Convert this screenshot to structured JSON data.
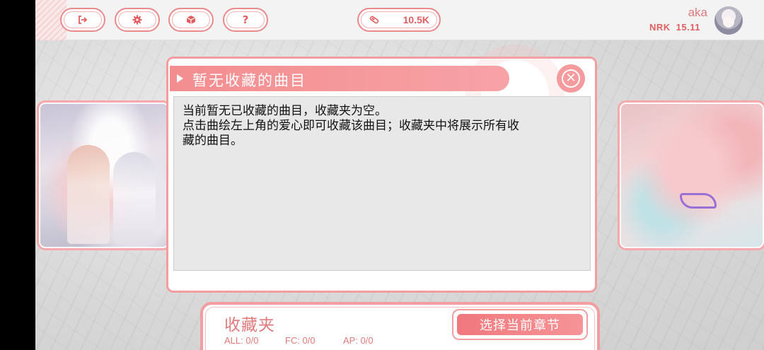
{
  "topbar": {
    "buttons": [
      {
        "name": "exit",
        "icon": "exit-icon"
      },
      {
        "name": "settings",
        "icon": "gear-icon"
      },
      {
        "name": "box",
        "icon": "cube-icon"
      },
      {
        "name": "help",
        "icon": "question-icon",
        "glyph": "?"
      }
    ],
    "data_value": "10.5K",
    "data_icon": "data-chip-icon",
    "user": {
      "name": "aka",
      "rank_label": "NRK",
      "rank_value": "15.11"
    }
  },
  "dialog": {
    "title": "暂无收藏的曲目",
    "body_lines": [
      "当前暂无已收藏的曲目，收藏夹为空。",
      "点击曲绘左上角的爱心即可收藏该曲目；收藏夹中将展示所有收",
      "藏的曲目。"
    ],
    "close_icon": "close-circle-icon"
  },
  "folder": {
    "title": "收藏夹",
    "stats": {
      "all": "ALL: 0/0",
      "fc": "FC: 0/0",
      "ap": "AP: 0/0"
    },
    "select_button": "选择当前章节"
  },
  "colors": {
    "accent": "#f29ea1",
    "accent_dark": "#e05e61",
    "dialog_body_bg": "#e8e8e8"
  }
}
